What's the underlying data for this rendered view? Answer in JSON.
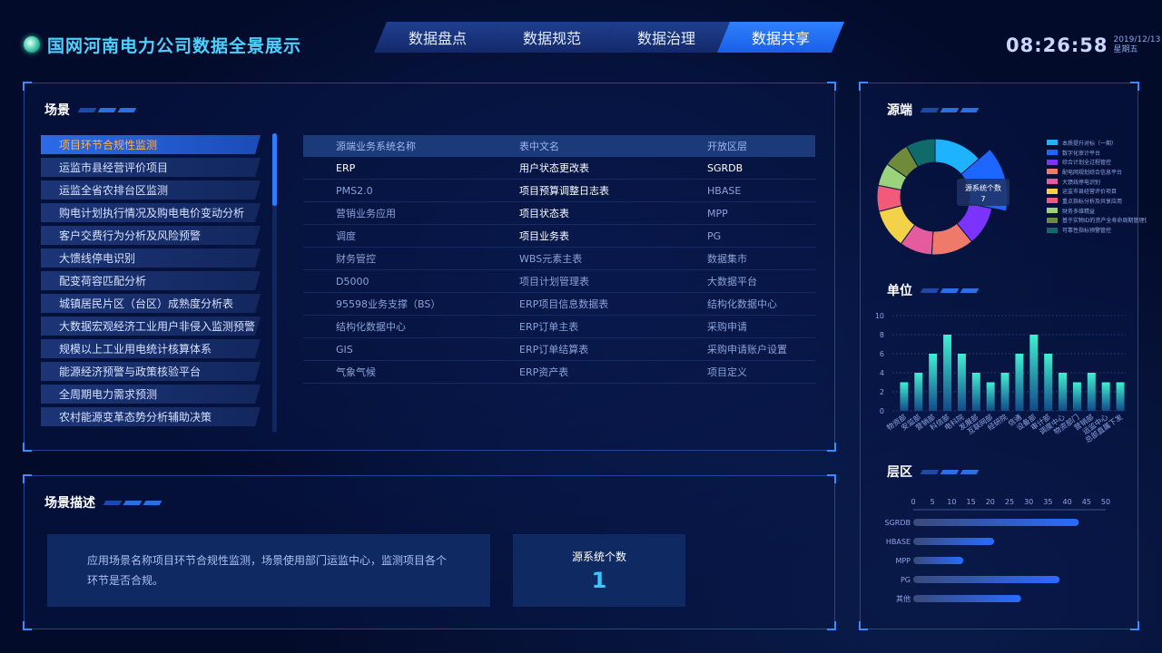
{
  "header": {
    "title": "国网河南电力公司数据全景展示",
    "time": "08:26:58",
    "date": "2019/12/13",
    "weekday": "星期五",
    "tabs": [
      {
        "label": "数据盘点",
        "active": false
      },
      {
        "label": "数据规范",
        "active": false
      },
      {
        "label": "数据治理",
        "active": false
      },
      {
        "label": "数据共享",
        "active": true
      }
    ]
  },
  "scenes": {
    "title": "场景",
    "items": [
      "项目环节合规性监测",
      "运监市县经营评价项目",
      "运监全省农排台区监测",
      "购电计划执行情况及购电电价变动分析",
      "客户交费行为分析及风险预警",
      "大馈线停电识别",
      "配变荷容匹配分析",
      "城镇居民片区（台区）成熟度分析表",
      "大数据宏观经济工业用户非侵入监测预警",
      "规模以上工业用电统计核算体系",
      "能源经济预警与政策核验平台",
      "全周期电力需求预测",
      "农村能源变革态势分析辅助决策"
    ],
    "active_index": 0
  },
  "table": {
    "headers": [
      "源端业务系统名称",
      "表中文名",
      "开放区层"
    ],
    "rows": [
      [
        "ERP",
        "用户状态更改表",
        "SGRDB"
      ],
      [
        "PMS2.0",
        "项目预算调整日志表",
        "HBASE"
      ],
      [
        "营销业务应用",
        "项目状态表",
        "MPP"
      ],
      [
        "调度",
        "项目业务表",
        "PG"
      ],
      [
        "财务管控",
        "WBS元素主表",
        "数据集市"
      ],
      [
        "D5000",
        "项目计划管理表",
        "大数据平台"
      ],
      [
        "95598业务支撑（BS）",
        "ERP项目信息数据表",
        "结构化数据中心"
      ],
      [
        "结构化数据中心",
        "ERP订单主表",
        "采购申请"
      ],
      [
        "GIS",
        "ERP订单结算表",
        "采购申请账户设置"
      ],
      [
        "气象气候",
        "ERP资产表",
        "项目定义"
      ]
    ]
  },
  "description": {
    "title": "场景描述",
    "line1": "应用场景名称项目环节合规性监测，场景使用部门运监中心，监测项目各个",
    "line2": "环节是否合规。",
    "count_label": "源系统个数",
    "count_value": "1"
  },
  "source_panel": {
    "title": "源端",
    "tooltip_label": "源系统个数",
    "tooltip_value": "7",
    "legend": [
      {
        "name": "本质提升对标（一期）",
        "color": "#1db3ff"
      },
      {
        "name": "数字化审计平台",
        "color": "#1e66ff"
      },
      {
        "name": "综合计划全过程管控",
        "color": "#7b33ff"
      },
      {
        "name": "配电网规划综合信息平台",
        "color": "#f07a6a"
      },
      {
        "name": "大馈线停电识别",
        "color": "#e65a9e"
      },
      {
        "name": "运监市县经营评价项目",
        "color": "#f3d24a"
      },
      {
        "name": "重点指标分析及共享应用",
        "color": "#f25a7a"
      },
      {
        "name": "财务多维精益",
        "color": "#9ad37a"
      },
      {
        "name": "基于实物ID的资产全寿命周期管理信息",
        "color": "#6f8a3a"
      },
      {
        "name": "可靠性指标预警管控",
        "color": "#0f6a6a"
      }
    ]
  },
  "chart_data": [
    {
      "type": "pie",
      "title": "源端",
      "labels": [
        "本质提升对标（一期）",
        "数字化审计平台",
        "综合计划全过程管控",
        "配电网规划综合信息平台",
        "大馈线停电识别",
        "运监市县经营评价项目",
        "重点指标分析及共享应用",
        "财务多维精益",
        "基于实物ID的资产全寿命周期管理信息",
        "可靠性指标预警管控"
      ],
      "values": [
        15,
        16,
        12,
        13,
        10,
        12,
        8,
        7,
        8,
        9
      ],
      "colors": [
        "#1db3ff",
        "#1e66ff",
        "#7b33ff",
        "#f07a6a",
        "#e65a9e",
        "#f3d24a",
        "#f25a7a",
        "#9ad37a",
        "#6f8a3a",
        "#0f6a6a"
      ],
      "highlight_index": 1
    },
    {
      "type": "bar",
      "title": "单位",
      "categories": [
        "物资部",
        "安监部",
        "营销部",
        "科信部",
        "电科院",
        "发展部",
        "互联网部",
        "经研院",
        "信通",
        "设备部",
        "审计部",
        "调度中心",
        "物资部门",
        "营销部",
        "运监中心",
        "总部直属下发"
      ],
      "values": [
        3,
        4,
        6,
        8,
        6,
        4,
        3,
        4,
        6,
        8,
        6,
        4,
        3,
        4,
        3,
        3
      ],
      "ylim": [
        0,
        10
      ],
      "yticks": [
        0,
        2,
        4,
        6,
        8,
        10
      ]
    },
    {
      "type": "bar",
      "orientation": "horizontal",
      "title": "层区",
      "categories": [
        "SGRDB",
        "HBASE",
        "MPP",
        "PG",
        "其他"
      ],
      "values": [
        43,
        21,
        13,
        38,
        28
      ],
      "xlim": [
        0,
        50
      ],
      "xticks": [
        0,
        5,
        10,
        15,
        20,
        25,
        30,
        35,
        40,
        45,
        50
      ]
    }
  ],
  "unit_panel": {
    "title": "单位"
  },
  "layer_panel": {
    "title": "层区"
  }
}
